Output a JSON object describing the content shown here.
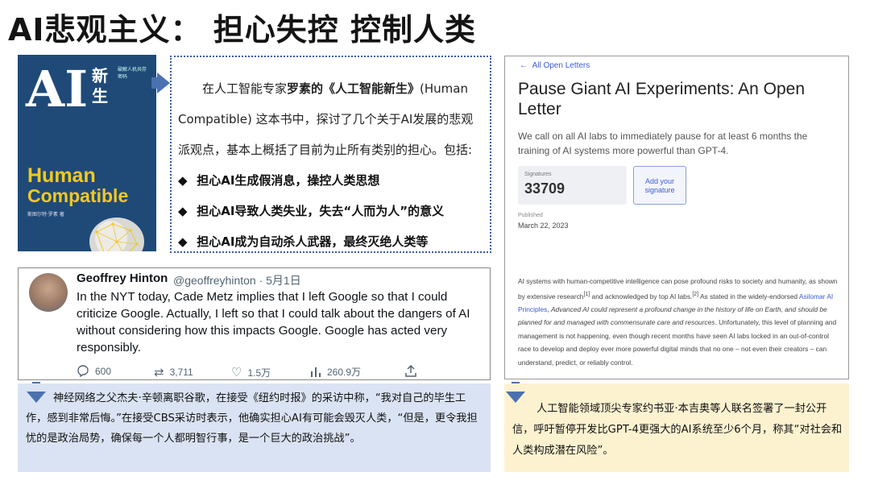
{
  "slide": {
    "title": "AI悲观主义： 担心失控 控制人类"
  },
  "book": {
    "cover_ai": "AI",
    "cover_cn_title": "新生",
    "cover_en_line1": "Human",
    "cover_en_line2": "Compatible",
    "cover_subtitle": "破解人机共存密码",
    "cover_author": "斯图尔特·罗素 著",
    "colors": {
      "background": "#1f4a78",
      "accent": "#f2c824"
    }
  },
  "description": {
    "para_pre": "在人工智能专家",
    "para_bold": "罗素的《人工智能新生》",
    "para_post": "(Human Compatible) 这本书中，探讨了几个关于AI发展的悲观派观点，基本上概括了目前为止所有类别的担心。包括:",
    "bullet_symbol": "◆",
    "bullets": [
      "担心AI生成假消息，操控人类思想",
      "担心AI导致人类失业，失去“人而为人”的意义",
      "担心AI成为自动杀人武器，最终灭绝人类等"
    ]
  },
  "tweet": {
    "name": "Geoffrey Hinton",
    "handle": "@geoffreyhinton · 5月1日",
    "text": "In the NYT today, Cade Metz implies that I left Google so that I could criticize Google. Actually, I left so that I could talk about the dangers of AI without considering how this impacts Google. Google has acted very responsibly.",
    "replies": "600",
    "retweets": "3,711",
    "likes": "1.5万",
    "views": "260.9万"
  },
  "letter": {
    "back_link": "All Open Letters",
    "title": "Pause Giant AI Experiments: An Open Letter",
    "subtitle": "We call on all AI labs to immediately pause for at least 6 months the training of AI systems more powerful than GPT-4.",
    "signatures_label": "Signatures",
    "signatures_value": "33709",
    "add_signature": "Add your signature",
    "published_label": "Published",
    "published_date": "March 22, 2023",
    "body_1": "AI systems with human-competitive intelligence can pose profound risks to society and humanity, as shown by extensive research",
    "ref_1": "[1]",
    "body_2": " and acknowledged by top AI labs.",
    "ref_2": "[2]",
    "body_3": " As stated in the widely-endorsed ",
    "body_link": "Asilomar AI Principles",
    "body_4": ", ",
    "body_italic": "Advanced AI could represent a profound change in the history of life on Earth, and should be planned for and managed with commensurate care and resources",
    "body_5": ". Unfortunately, this level of planning and management is not happening, even though recent months have seen AI labs locked in an out-of-control race to develop and deploy ever more powerful digital minds that no one – not even their creators – can understand, predict, or reliably control."
  },
  "captions": {
    "left": "神经网络之父杰夫·辛顿离职谷歌，在接受《纽约时报》的采访中称，“我对自己的毕生工作，感到非常后悔。”在接受CBS采访时表示，他确实担心AI有可能会毁灭人类，“但是，更令我担忧的是政治局势，确保每一个人都明智行事，是一个巨大的政治挑战”。",
    "right": "人工智能领域顶尖专家约书亚·本吉奥等人联名签署了一封公开信，呼吁暂停开发比GPT-4更强大的AI系统至少6个月，称其“对社会和人类构成潜在风险”。",
    "colors": {
      "left_bg": "#dae3f3",
      "right_bg": "#fdf2d0",
      "arrow": "#4a72b0"
    }
  }
}
